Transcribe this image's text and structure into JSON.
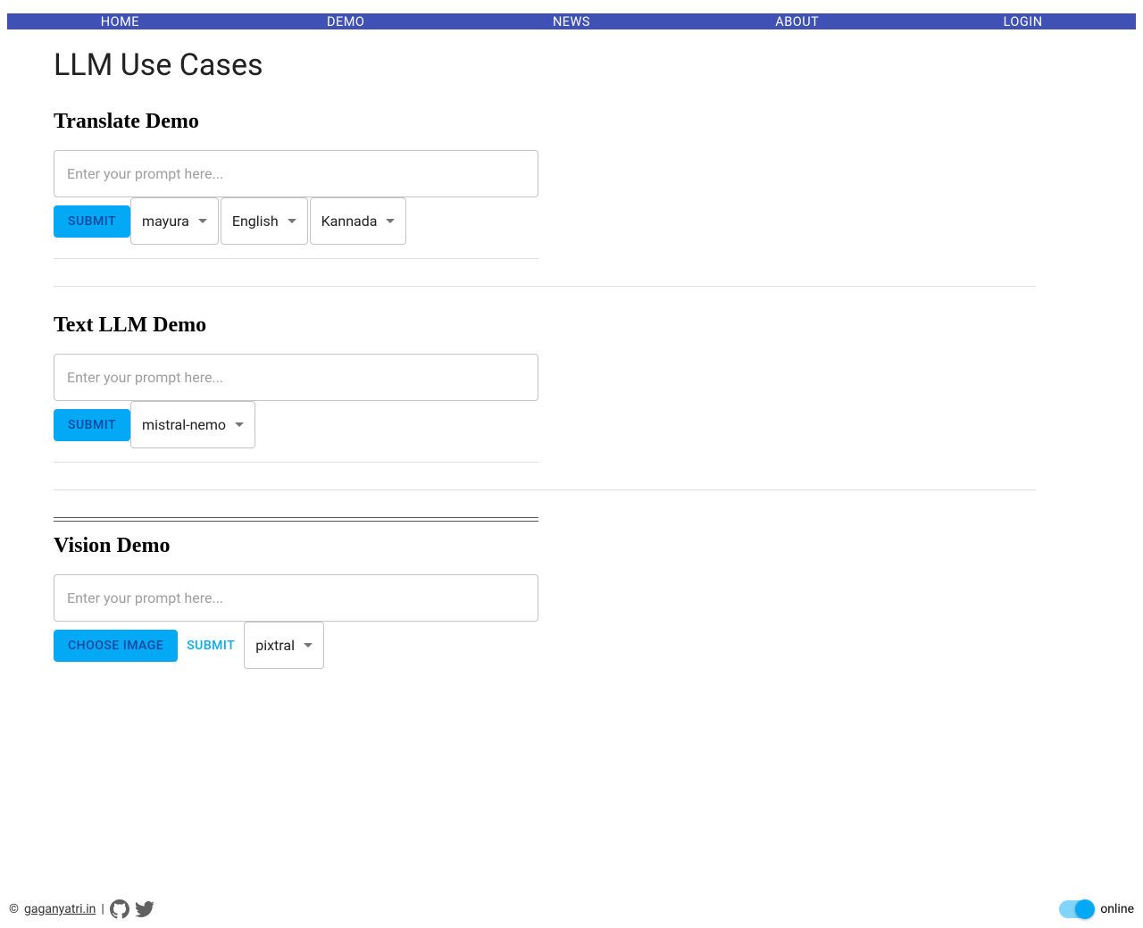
{
  "nav": {
    "home": "HOME",
    "demo": "DEMO",
    "news": "NEWS",
    "about": "ABOUT",
    "login": "LOGIN"
  },
  "page_title": "LLM Use Cases",
  "translate": {
    "title": "Translate Demo",
    "placeholder": "Enter your prompt here...",
    "submit": "Submit",
    "model": "mayura",
    "source_lang": "English",
    "target_lang": "Kannada"
  },
  "textllm": {
    "title": "Text LLM Demo",
    "placeholder": "Enter your prompt here...",
    "submit": "Submit",
    "model": "mistral-nemo"
  },
  "vision": {
    "title": "Vision Demo",
    "placeholder": "Enter your prompt here...",
    "choose_image": "Choose Image",
    "submit": "Submit",
    "model": "pixtral"
  },
  "footer": {
    "copyright": "©",
    "link": "gaganyatri.in",
    "separator": " | ",
    "status": "online"
  }
}
